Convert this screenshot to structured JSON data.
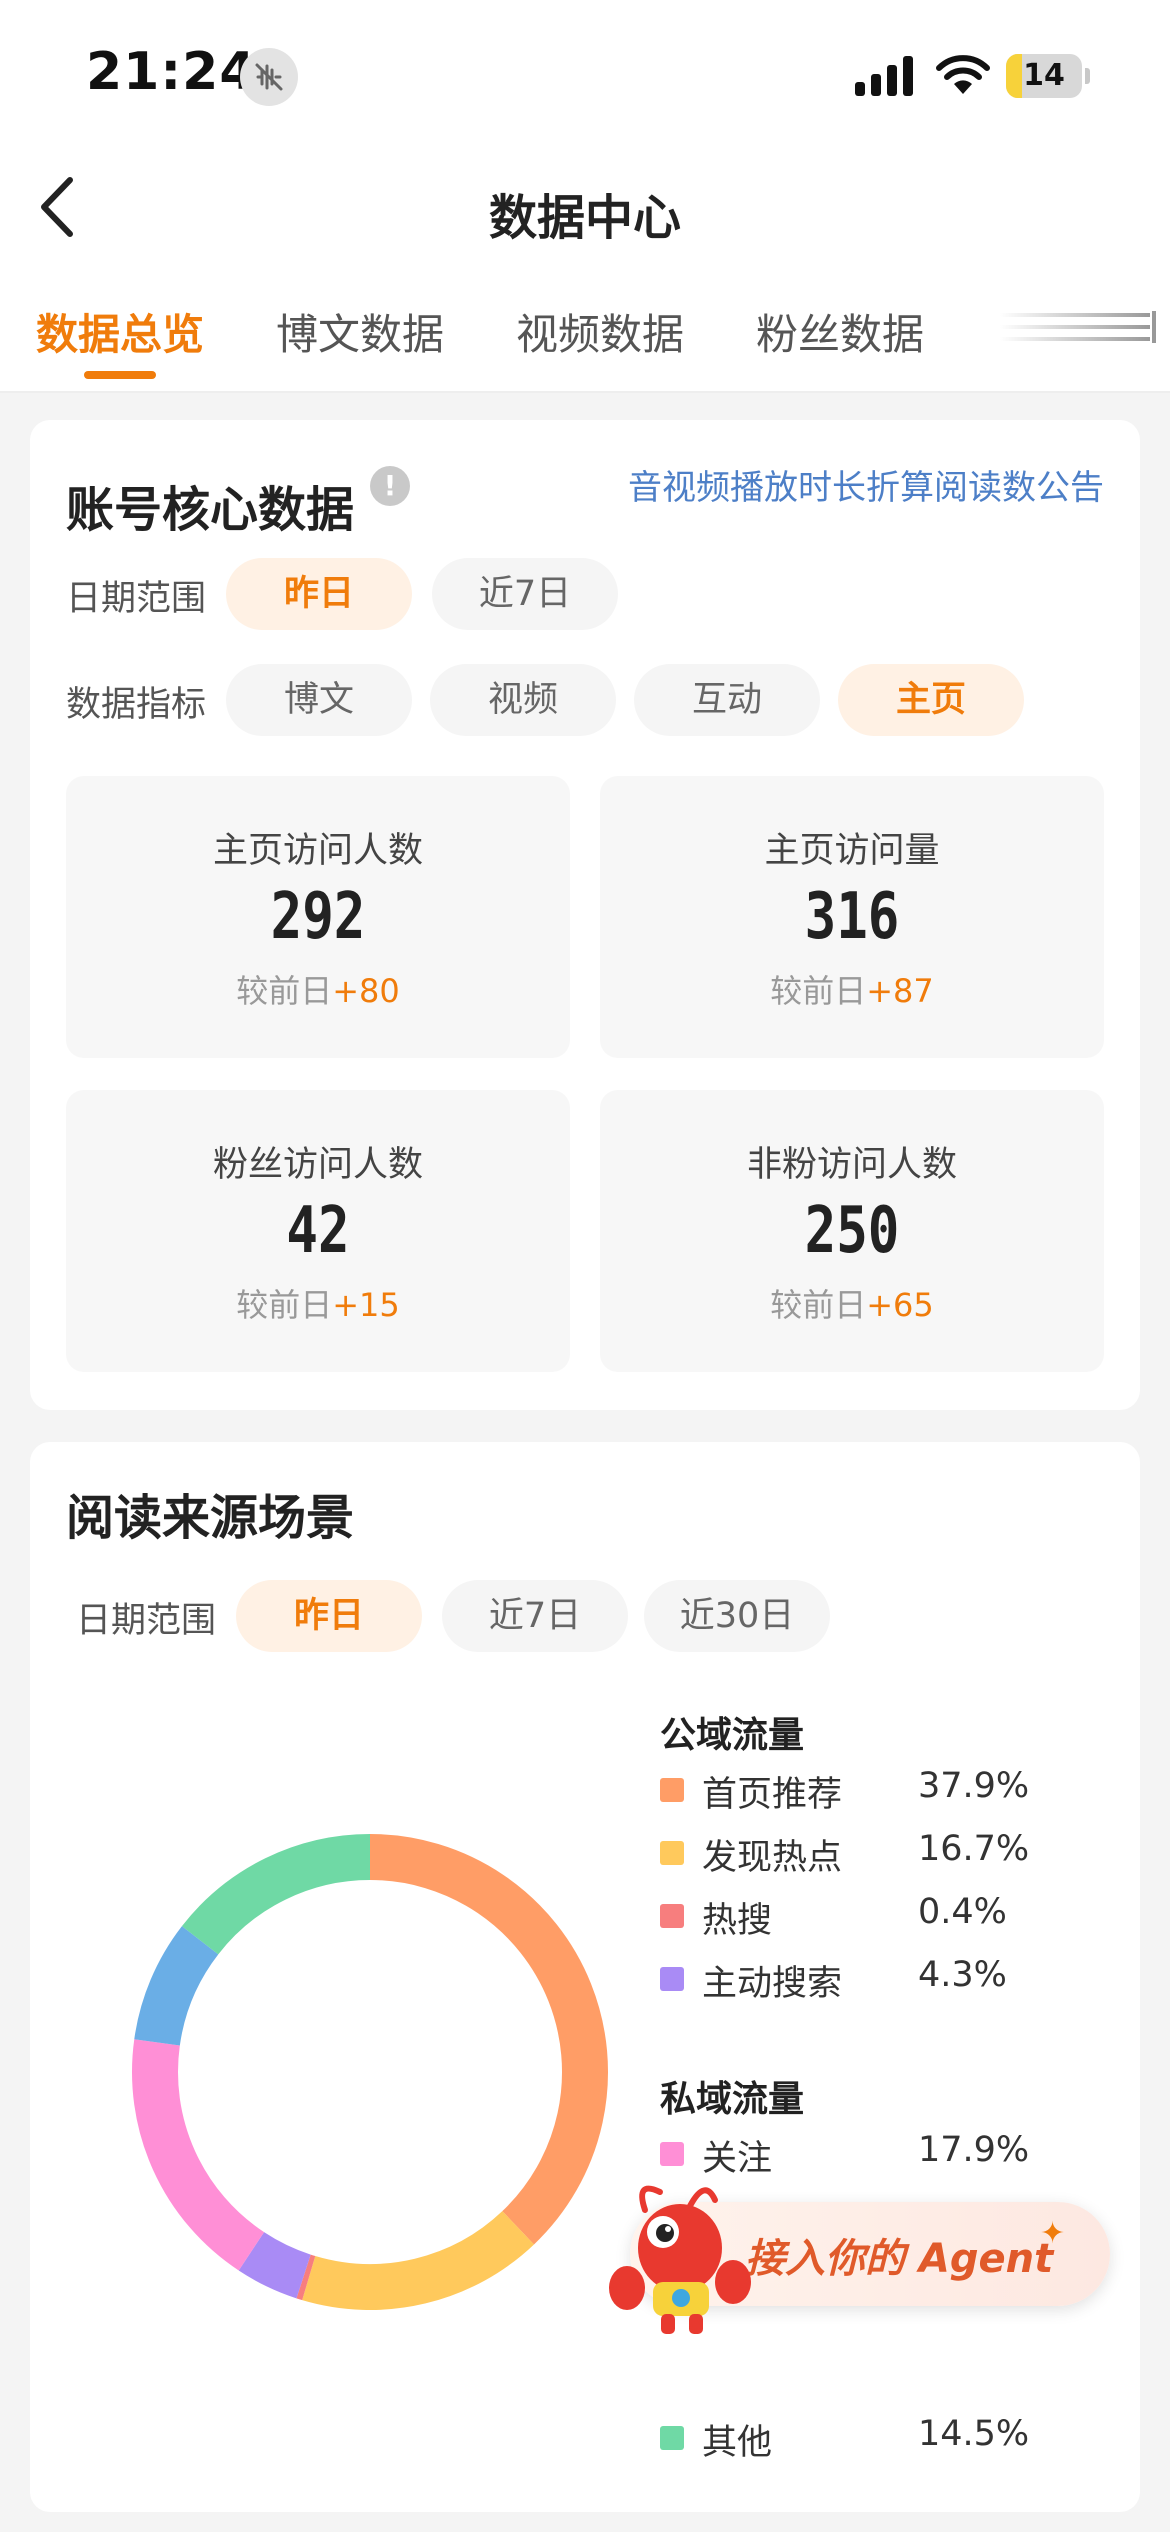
{
  "status_bar": {
    "time": "21:24",
    "battery": "14"
  },
  "header": {
    "title": "数据中心"
  },
  "tabs": [
    {
      "label": "数据总览",
      "active": true
    },
    {
      "label": "博文数据",
      "active": false
    },
    {
      "label": "视频数据",
      "active": false
    },
    {
      "label": "粉丝数据",
      "active": false
    }
  ],
  "core_card": {
    "title": "账号核心数据",
    "notice_link": "音视频播放时长折算阅读数公告",
    "date_range": {
      "label": "日期范围",
      "options": [
        "昨日",
        "近7日"
      ],
      "selected": "昨日"
    },
    "metric": {
      "label": "数据指标",
      "options": [
        "博文",
        "视频",
        "互动",
        "主页"
      ],
      "selected": "主页"
    },
    "stats": [
      {
        "label": "主页访问人数",
        "value": "292",
        "compare_prefix": "较前日",
        "delta": "+80"
      },
      {
        "label": "主页访问量",
        "value": "316",
        "compare_prefix": "较前日",
        "delta": "+87"
      },
      {
        "label": "粉丝访问人数",
        "value": "42",
        "compare_prefix": "较前日",
        "delta": "+15"
      },
      {
        "label": "非粉访问人数",
        "value": "250",
        "compare_prefix": "较前日",
        "delta": "+65"
      }
    ]
  },
  "source_card": {
    "title": "阅读来源场景",
    "date_range": {
      "label": "日期范围",
      "options": [
        "昨日",
        "近7日",
        "近30日"
      ],
      "selected": "昨日"
    },
    "groups": {
      "public": "公域流量",
      "private": "私域流量"
    },
    "legend": [
      {
        "name": "首页推荐",
        "pct": "37.9%",
        "color": "#ff9d66"
      },
      {
        "name": "发现热点",
        "pct": "16.7%",
        "color": "#ffc95c"
      },
      {
        "name": "热搜",
        "pct": "0.4%",
        "color": "#f77e7e"
      },
      {
        "name": "主动搜索",
        "pct": "4.3%",
        "color": "#a98bf5"
      },
      {
        "name": "关注",
        "pct": "17.9%",
        "color": "#ff8fd6"
      },
      {
        "name": "其他",
        "pct": "14.5%",
        "color": "#6fd9a5"
      }
    ]
  },
  "chart_data": {
    "type": "pie",
    "donut": true,
    "segments": [
      {
        "name": "首页推荐",
        "value": 37.9,
        "color": "#ff9d66"
      },
      {
        "name": "发现热点",
        "value": 16.7,
        "color": "#ffc95c"
      },
      {
        "name": "热搜",
        "value": 0.4,
        "color": "#f77e7e"
      },
      {
        "name": "主动搜索",
        "value": 4.3,
        "color": "#a98bf5"
      },
      {
        "name": "关注",
        "value": 17.9,
        "color": "#ff8fd6"
      },
      {
        "value": 8.3,
        "color": "#6aaee6"
      },
      {
        "name": "其他",
        "value": 14.5,
        "color": "#6fd9a5"
      }
    ]
  },
  "agent_banner": {
    "text": "接入你的 Agent"
  }
}
